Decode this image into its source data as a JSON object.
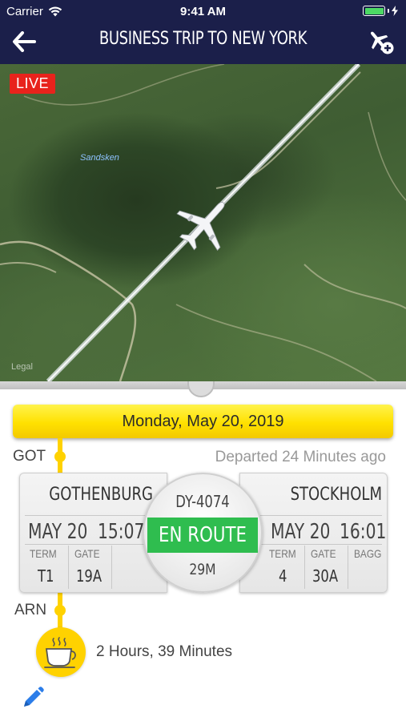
{
  "status_bar": {
    "carrier": "Carrier",
    "time": "9:41 AM"
  },
  "nav": {
    "title": "BUSINESS TRIP TO NEW YORK",
    "back_icon": "back-arrow-icon",
    "add_icon": "add-flight-icon"
  },
  "map": {
    "live_label": "LIVE",
    "lake_label": "Sandsken",
    "legal_label": "Legal"
  },
  "date_banner": "Monday, May 20, 2019",
  "departure": {
    "code": "GOT",
    "status_text": "Departed 24 Minutes ago",
    "city": "GOTHENBURG",
    "date": "MAY 20",
    "time": "15:07",
    "term_label": "TERM",
    "gate_label": "GATE",
    "term": "T1",
    "gate": "19A"
  },
  "flight": {
    "number": "DY-4074",
    "status": "EN ROUTE",
    "remaining": "29M"
  },
  "arrival": {
    "code": "ARN",
    "city": "STOCKHOLM",
    "date": "MAY 20",
    "time": "16:01",
    "term_label": "TERM",
    "gate_label": "GATE",
    "bagg_label": "BAGG",
    "term": "4",
    "gate": "30A",
    "bagg": ""
  },
  "layover": {
    "duration": "2 Hours, 39 Minutes",
    "icon": "coffee-cup-icon"
  },
  "colors": {
    "nav_bg": "#1b1f4a",
    "accent_yellow": "#ffd200",
    "status_green": "#2fbd4f",
    "live_red": "#e8231c"
  }
}
